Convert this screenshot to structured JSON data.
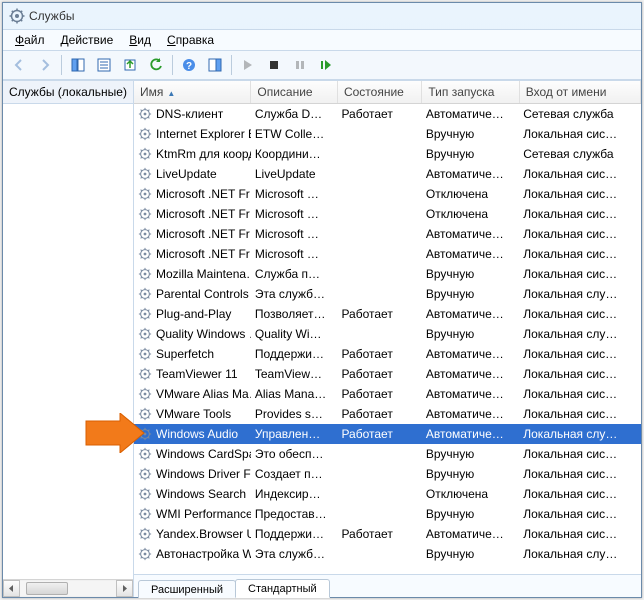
{
  "window_title": "Службы",
  "menu": [
    "Файл",
    "Действие",
    "Вид",
    "Справка"
  ],
  "tree_item": "Службы (локальные)",
  "columns": [
    {
      "key": "name",
      "label": "Имя",
      "width": 108
    },
    {
      "key": "desc",
      "label": "Описание",
      "width": 80
    },
    {
      "key": "state",
      "label": "Состояние",
      "width": 78
    },
    {
      "key": "startup",
      "label": "Тип запуска",
      "width": 90
    },
    {
      "key": "logon",
      "label": "Вход от имени",
      "width": 112
    }
  ],
  "tabs": [
    {
      "label": "Расширенный",
      "active": false
    },
    {
      "label": "Стандартный",
      "active": true
    }
  ],
  "selected_index": 16,
  "services": [
    {
      "name": "DNS-клиент",
      "desc": "Служба D…",
      "state": "Работает",
      "startup": "Автоматиче…",
      "logon": "Сетевая служба"
    },
    {
      "name": "Internet Explorer E…",
      "desc": "ETW Colle…",
      "state": "",
      "startup": "Вручную",
      "logon": "Локальная сис…"
    },
    {
      "name": "KtmRm для коорд…",
      "desc": "Координи…",
      "state": "",
      "startup": "Вручную",
      "logon": "Сетевая служба"
    },
    {
      "name": "LiveUpdate",
      "desc": "LiveUpdate",
      "state": "",
      "startup": "Автоматиче…",
      "logon": "Локальная сис…"
    },
    {
      "name": "Microsoft .NET Fr…",
      "desc": "Microsoft …",
      "state": "",
      "startup": "Отключена",
      "logon": "Локальная сис…"
    },
    {
      "name": "Microsoft .NET Fr…",
      "desc": "Microsoft …",
      "state": "",
      "startup": "Отключена",
      "logon": "Локальная сис…"
    },
    {
      "name": "Microsoft .NET Fr…",
      "desc": "Microsoft …",
      "state": "",
      "startup": "Автоматиче…",
      "logon": "Локальная сис…"
    },
    {
      "name": "Microsoft .NET Fr…",
      "desc": "Microsoft …",
      "state": "",
      "startup": "Автоматиче…",
      "logon": "Локальная сис…"
    },
    {
      "name": "Mozilla Maintena…",
      "desc": "Служба п…",
      "state": "",
      "startup": "Вручную",
      "logon": "Локальная сис…"
    },
    {
      "name": "Parental Controls",
      "desc": "Эта служб…",
      "state": "",
      "startup": "Вручную",
      "logon": "Локальная слу…"
    },
    {
      "name": "Plug-and-Play",
      "desc": "Позволяет…",
      "state": "Работает",
      "startup": "Автоматиче…",
      "logon": "Локальная сис…"
    },
    {
      "name": "Quality Windows …",
      "desc": "Quality Wi…",
      "state": "",
      "startup": "Вручную",
      "logon": "Локальная слу…"
    },
    {
      "name": "Superfetch",
      "desc": "Поддержи…",
      "state": "Работает",
      "startup": "Автоматиче…",
      "logon": "Локальная сис…"
    },
    {
      "name": "TeamViewer 11",
      "desc": "TeamView…",
      "state": "Работает",
      "startup": "Автоматиче…",
      "logon": "Локальная сис…"
    },
    {
      "name": "VMware Alias Ma…",
      "desc": "Alias Mana…",
      "state": "Работает",
      "startup": "Автоматиче…",
      "logon": "Локальная сис…"
    },
    {
      "name": "VMware Tools",
      "desc": "Provides s…",
      "state": "Работает",
      "startup": "Автоматиче…",
      "logon": "Локальная сис…"
    },
    {
      "name": "Windows Audio",
      "desc": "Управлен…",
      "state": "Работает",
      "startup": "Автоматиче…",
      "logon": "Локальная слу…"
    },
    {
      "name": "Windows CardSpa…",
      "desc": "Это обесп…",
      "state": "",
      "startup": "Вручную",
      "logon": "Локальная сис…"
    },
    {
      "name": "Windows Driver F…",
      "desc": "Создает п…",
      "state": "",
      "startup": "Вручную",
      "logon": "Локальная сис…"
    },
    {
      "name": "Windows Search",
      "desc": "Индексир…",
      "state": "",
      "startup": "Отключена",
      "logon": "Локальная сис…"
    },
    {
      "name": "WMI Performance…",
      "desc": "Предостав…",
      "state": "",
      "startup": "Вручную",
      "logon": "Локальная сис…"
    },
    {
      "name": "Yandex.Browser U…",
      "desc": "Поддержи…",
      "state": "Работает",
      "startup": "Автоматиче…",
      "logon": "Локальная сис…"
    },
    {
      "name": "Автонастройка W…",
      "desc": "Эта служб…",
      "state": "",
      "startup": "Вручную",
      "logon": "Локальная слу…"
    }
  ]
}
